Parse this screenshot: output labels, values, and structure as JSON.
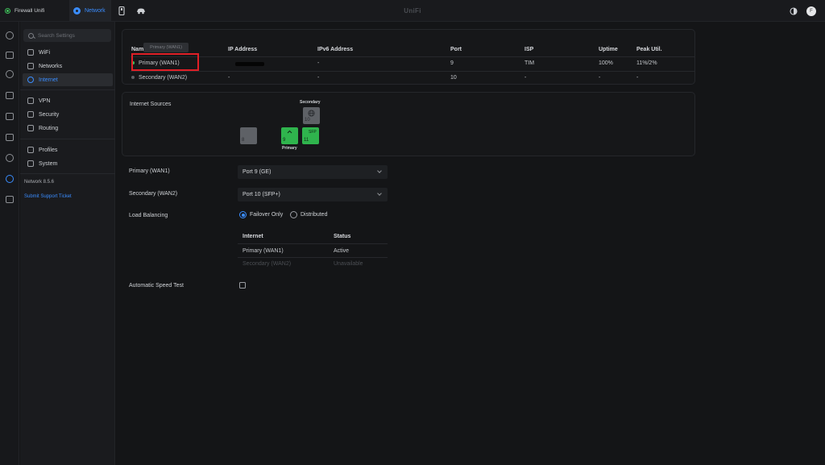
{
  "topbar": {
    "site_name": "Firewall Unifi",
    "network_tab": "Network",
    "app_title": "UniFi",
    "avatar_initial": "F"
  },
  "sidebar": {
    "search_placeholder": "Search Settings",
    "items": [
      {
        "label": "WiFi"
      },
      {
        "label": "Networks"
      },
      {
        "label": "Internet"
      },
      {
        "label": "VPN"
      },
      {
        "label": "Security"
      },
      {
        "label": "Routing"
      },
      {
        "label": "Profiles"
      },
      {
        "label": "System"
      }
    ],
    "active_item": "Internet",
    "version": "Network 8.5.6",
    "support_link": "Submit Support Ticket"
  },
  "wan_table": {
    "headers": [
      "Name",
      "IP Address",
      "IPv6 Address",
      "Port",
      "ISP",
      "Uptime",
      "Peak Util."
    ],
    "tooltip": "Primary (WAN1)",
    "rows": [
      {
        "name": "Primary (WAN1)",
        "ip": "",
        "ipv6": "-",
        "port": "9",
        "isp": "TIM",
        "uptime": "100%",
        "peak": "11%/2%",
        "status_color": "#3ec25a"
      },
      {
        "name": "Secondary (WAN2)",
        "ip": "-",
        "ipv6": "-",
        "port": "10",
        "isp": "-",
        "uptime": "-",
        "peak": "-",
        "status_color": "#5e6166"
      }
    ]
  },
  "internet_sources": {
    "title": "Internet Sources",
    "ports": [
      {
        "number": "8",
        "state": "inactive"
      },
      {
        "number": "9",
        "state": "primary"
      },
      {
        "number": "11",
        "label": "SFP",
        "state": "active"
      },
      {
        "number": "10",
        "state": "secondary"
      }
    ],
    "primary_label": "Primary",
    "secondary_label": "Secondary"
  },
  "form": {
    "primary_label": "Primary (WAN1)",
    "primary_value": "Port 9 (GE)",
    "secondary_label": "Secondary (WAN2)",
    "secondary_value": "Port 10 (SFP+)",
    "load_balancing_label": "Load Balancing",
    "lb_options": [
      "Failover Only",
      "Distributed"
    ],
    "lb_selected": "Failover Only",
    "lb_table": {
      "headers": [
        "Internet",
        "Status"
      ],
      "rows": [
        {
          "internet": "Primary (WAN1)",
          "status": "Active"
        },
        {
          "internet": "Secondary (WAN2)",
          "status": "Unavailable"
        }
      ]
    },
    "speed_test_label": "Automatic Speed Test",
    "speed_test_checked": false
  },
  "colors": {
    "accent": "#3a8dff",
    "active_green": "#2fb44d",
    "highlight_red": "#e01f26"
  }
}
